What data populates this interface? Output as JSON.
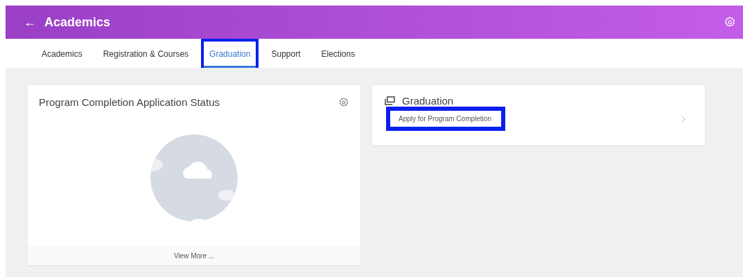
{
  "header": {
    "title": "Academics",
    "back": "←"
  },
  "tabs": [
    {
      "label": "Academics",
      "selected": false,
      "highlighted": false
    },
    {
      "label": "Registration & Courses",
      "selected": false,
      "highlighted": false
    },
    {
      "label": "Graduation",
      "selected": true,
      "highlighted": true
    },
    {
      "label": "Support",
      "selected": false,
      "highlighted": false
    },
    {
      "label": "Elections",
      "selected": false,
      "highlighted": false
    }
  ],
  "status_card": {
    "title": "Program Completion Application Status",
    "footer_link": "View More ..."
  },
  "graduation_card": {
    "title": "Graduation",
    "links": [
      {
        "label": "Apply for Program Completion",
        "highlighted": true
      }
    ]
  }
}
